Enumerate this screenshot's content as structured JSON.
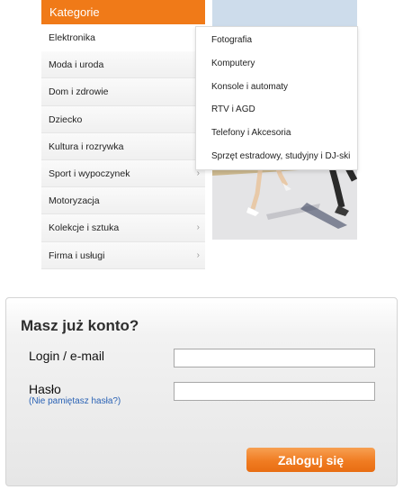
{
  "categories": {
    "header": "Kategorie",
    "items": [
      {
        "label": "Elektronika",
        "active": true,
        "has_submenu": false
      },
      {
        "label": "Moda i uroda",
        "has_submenu": false
      },
      {
        "label": "Dom i zdrowie",
        "has_submenu": false
      },
      {
        "label": "Dziecko",
        "has_submenu": false
      },
      {
        "label": "Kultura i rozrywka",
        "has_submenu": false
      },
      {
        "label": "Sport i wypoczynek",
        "has_submenu": true
      },
      {
        "label": "Motoryzacja",
        "has_submenu": false
      },
      {
        "label": "Kolekcje i sztuka",
        "has_submenu": true
      },
      {
        "label": "Firma i usługi",
        "has_submenu": true
      }
    ]
  },
  "submenu": {
    "items": [
      "Fotografia",
      "Komputery",
      "Konsole i automaty",
      "RTV i AGD",
      "Telefony i Akcesoria",
      "Sprzęt estradowy, studyjny i DJ-ski"
    ]
  },
  "login": {
    "title": "Masz już konto?",
    "login_label": "Login / e-mail",
    "login_value": "",
    "password_label": "Hasło",
    "password_value": "",
    "forgot_link": "(Nie pamiętasz hasła?)",
    "submit_label": "Zaloguj się"
  },
  "colors": {
    "accent": "#f07a18",
    "link": "#2b63b5"
  }
}
